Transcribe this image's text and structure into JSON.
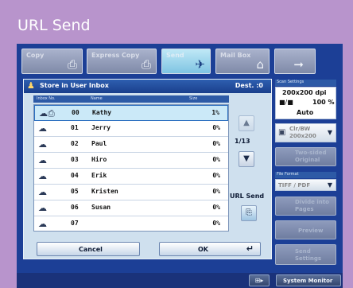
{
  "caption": "URL Send",
  "tabs": [
    {
      "label": "Copy",
      "icon": "copy-icon",
      "glyph": "⎙"
    },
    {
      "label": "Express Copy",
      "icon": "express-copy-icon",
      "glyph": "⎙"
    },
    {
      "label": "Send",
      "icon": "send-icon",
      "glyph": "✈",
      "selected": true
    },
    {
      "label": "Mail Box",
      "icon": "mailbox-icon",
      "glyph": "⌂"
    },
    {
      "label": "",
      "icon": "arrow-right-icon",
      "glyph": "➞"
    }
  ],
  "panel": {
    "title": "Store in User Inbox",
    "dest": "Dest. :0",
    "col_no": "Inbox No.",
    "col_name": "Name",
    "col_size": "Size",
    "page": "1/13",
    "url_send": "URL Send",
    "cancel": "Cancel",
    "ok": "OK"
  },
  "inbox": [
    {
      "no": "00",
      "name": "Kathy",
      "size": "1%",
      "selected": true
    },
    {
      "no": "01",
      "name": "Jerry",
      "size": "0%"
    },
    {
      "no": "02",
      "name": "Paul",
      "size": "0%"
    },
    {
      "no": "03",
      "name": "Hiro",
      "size": "0%"
    },
    {
      "no": "04",
      "name": "Erik",
      "size": "0%"
    },
    {
      "no": "05",
      "name": "Kristen",
      "size": "0%"
    },
    {
      "no": "06",
      "name": "Susan",
      "size": "0%"
    },
    {
      "no": "07",
      "name": "",
      "size": "0%"
    }
  ],
  "scan": {
    "header": "Scan Settings",
    "resolution": "200x200 dpi",
    "ratio": "100 %",
    "density": "Auto",
    "color": "Clr/BW",
    "color_res": "200x200",
    "two_sided": "Two-sided Original"
  },
  "file_format": {
    "header": "File Format",
    "value": "TIFF / PDF"
  },
  "side_buttons": [
    "Divide into Pages",
    "Preview",
    "Send Settings"
  ],
  "footer": {
    "system_monitor": "System Monitor"
  },
  "colors": {
    "accent": "#1c3f96",
    "selection": "#cbe9f8",
    "frame": "#b894cc"
  }
}
